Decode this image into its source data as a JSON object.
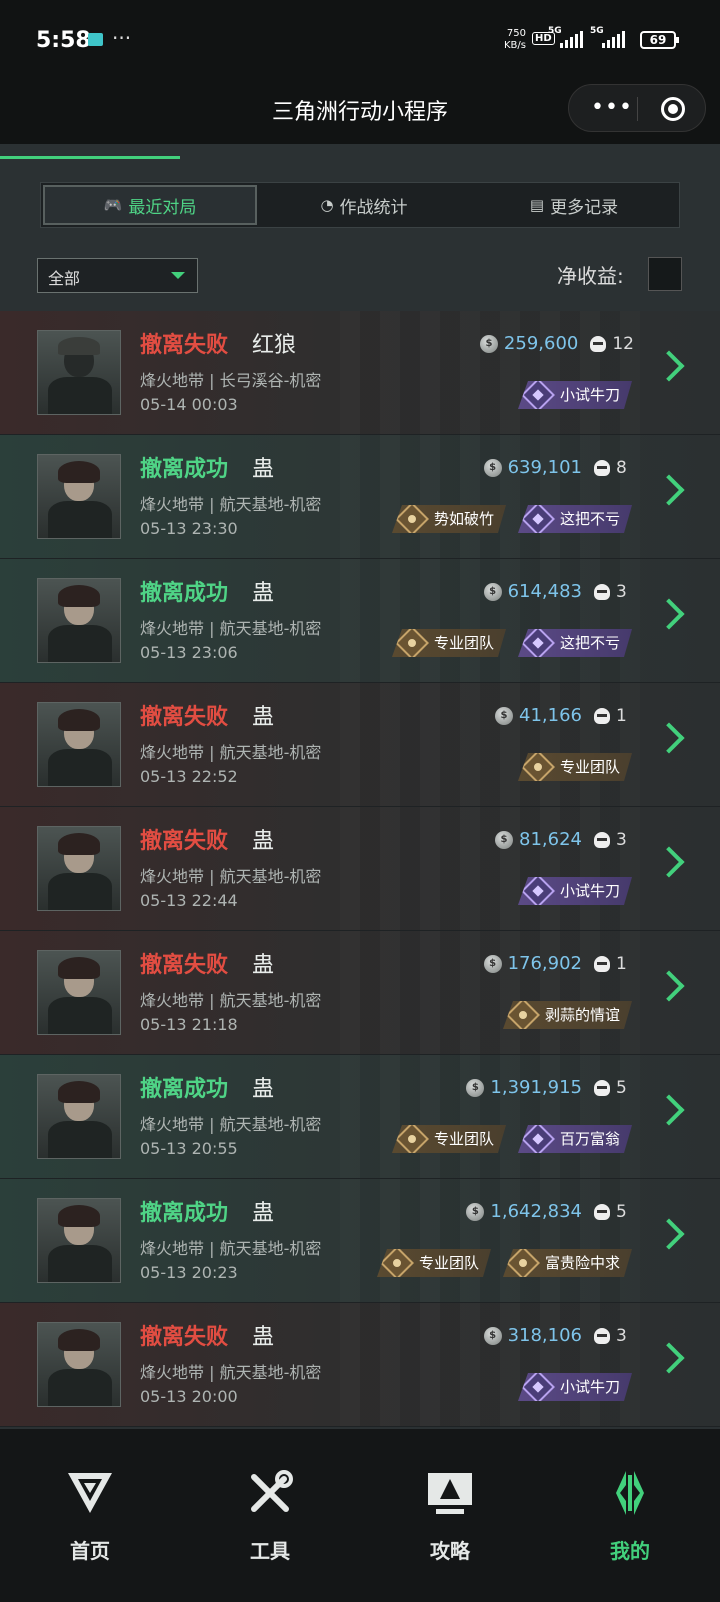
{
  "status_bar": {
    "time": "5:58",
    "speed_value": "750",
    "speed_unit": "KB/s",
    "hd": "HD",
    "sim1": "5G",
    "sim2": "5G",
    "battery": "69"
  },
  "titlebar": {
    "title": "三角洲行动小程序",
    "more": "•••"
  },
  "tabs": [
    {
      "label": "最近对局",
      "icon": "gamepad-icon"
    },
    {
      "label": "作战统计",
      "icon": "pie-chart-icon"
    },
    {
      "label": "更多记录",
      "icon": "document-icon"
    }
  ],
  "filter": {
    "selected": "全部"
  },
  "net_income_label": "净收益:",
  "matches": [
    {
      "result": "撤离失败",
      "status": "fail",
      "player": "红狼",
      "map": "烽火地带 | 长弓溪谷-机密",
      "time": "05-14 00:03",
      "value": "259,600",
      "kills": "12",
      "avatar": "helmet",
      "badges": [
        {
          "type": "purple",
          "label": "小试牛刀"
        }
      ]
    },
    {
      "result": "撤离成功",
      "status": "ok",
      "player": "蛊",
      "map": "烽火地带 | 航天基地-机密",
      "time": "05-13 23:30",
      "value": "639,101",
      "kills": "8",
      "avatar": "girl",
      "badges": [
        {
          "type": "gold",
          "label": "势如破竹"
        },
        {
          "type": "purple",
          "label": "这把不亏"
        }
      ]
    },
    {
      "result": "撤离成功",
      "status": "ok",
      "player": "蛊",
      "map": "烽火地带 | 航天基地-机密",
      "time": "05-13 23:06",
      "value": "614,483",
      "kills": "3",
      "avatar": "girl",
      "badges": [
        {
          "type": "gold",
          "label": "专业团队"
        },
        {
          "type": "purple",
          "label": "这把不亏"
        }
      ]
    },
    {
      "result": "撤离失败",
      "status": "fail",
      "player": "蛊",
      "map": "烽火地带 | 航天基地-机密",
      "time": "05-13 22:52",
      "value": "41,166",
      "kills": "1",
      "avatar": "girl",
      "badges": [
        {
          "type": "gold",
          "label": "专业团队"
        }
      ]
    },
    {
      "result": "撤离失败",
      "status": "fail",
      "player": "蛊",
      "map": "烽火地带 | 航天基地-机密",
      "time": "05-13 22:44",
      "value": "81,624",
      "kills": "3",
      "avatar": "girl",
      "badges": [
        {
          "type": "purple",
          "label": "小试牛刀"
        }
      ]
    },
    {
      "result": "撤离失败",
      "status": "fail",
      "player": "蛊",
      "map": "烽火地带 | 航天基地-机密",
      "time": "05-13 21:18",
      "value": "176,902",
      "kills": "1",
      "avatar": "girl",
      "badges": [
        {
          "type": "gold",
          "label": "剥蒜的情谊"
        }
      ]
    },
    {
      "result": "撤离成功",
      "status": "ok",
      "player": "蛊",
      "map": "烽火地带 | 航天基地-机密",
      "time": "05-13 20:55",
      "value": "1,391,915",
      "kills": "5",
      "avatar": "girl",
      "badges": [
        {
          "type": "gold",
          "label": "专业团队"
        },
        {
          "type": "purple",
          "label": "百万富翁"
        }
      ]
    },
    {
      "result": "撤离成功",
      "status": "ok",
      "player": "蛊",
      "map": "烽火地带 | 航天基地-机密",
      "time": "05-13 20:23",
      "value": "1,642,834",
      "kills": "5",
      "avatar": "girl",
      "badges": [
        {
          "type": "gold",
          "label": "专业团队"
        },
        {
          "type": "gold",
          "label": "富贵险中求"
        }
      ]
    },
    {
      "result": "撤离失败",
      "status": "fail",
      "player": "蛊",
      "map": "烽火地带 | 航天基地-机密",
      "time": "05-13 20:00",
      "value": "318,106",
      "kills": "3",
      "avatar": "girl",
      "badges": [
        {
          "type": "purple",
          "label": "小试牛刀"
        }
      ]
    }
  ],
  "bottom_nav": [
    {
      "label": "首页",
      "icon": "home-logo-icon"
    },
    {
      "label": "工具",
      "icon": "tools-icon"
    },
    {
      "label": "攻略",
      "icon": "guide-monitor-icon"
    },
    {
      "label": "我的",
      "icon": "profile-logo-icon",
      "active": true
    }
  ],
  "colors": {
    "accent": "#42d07c",
    "fail": "#e24d42",
    "value": "#7ec4ea"
  }
}
